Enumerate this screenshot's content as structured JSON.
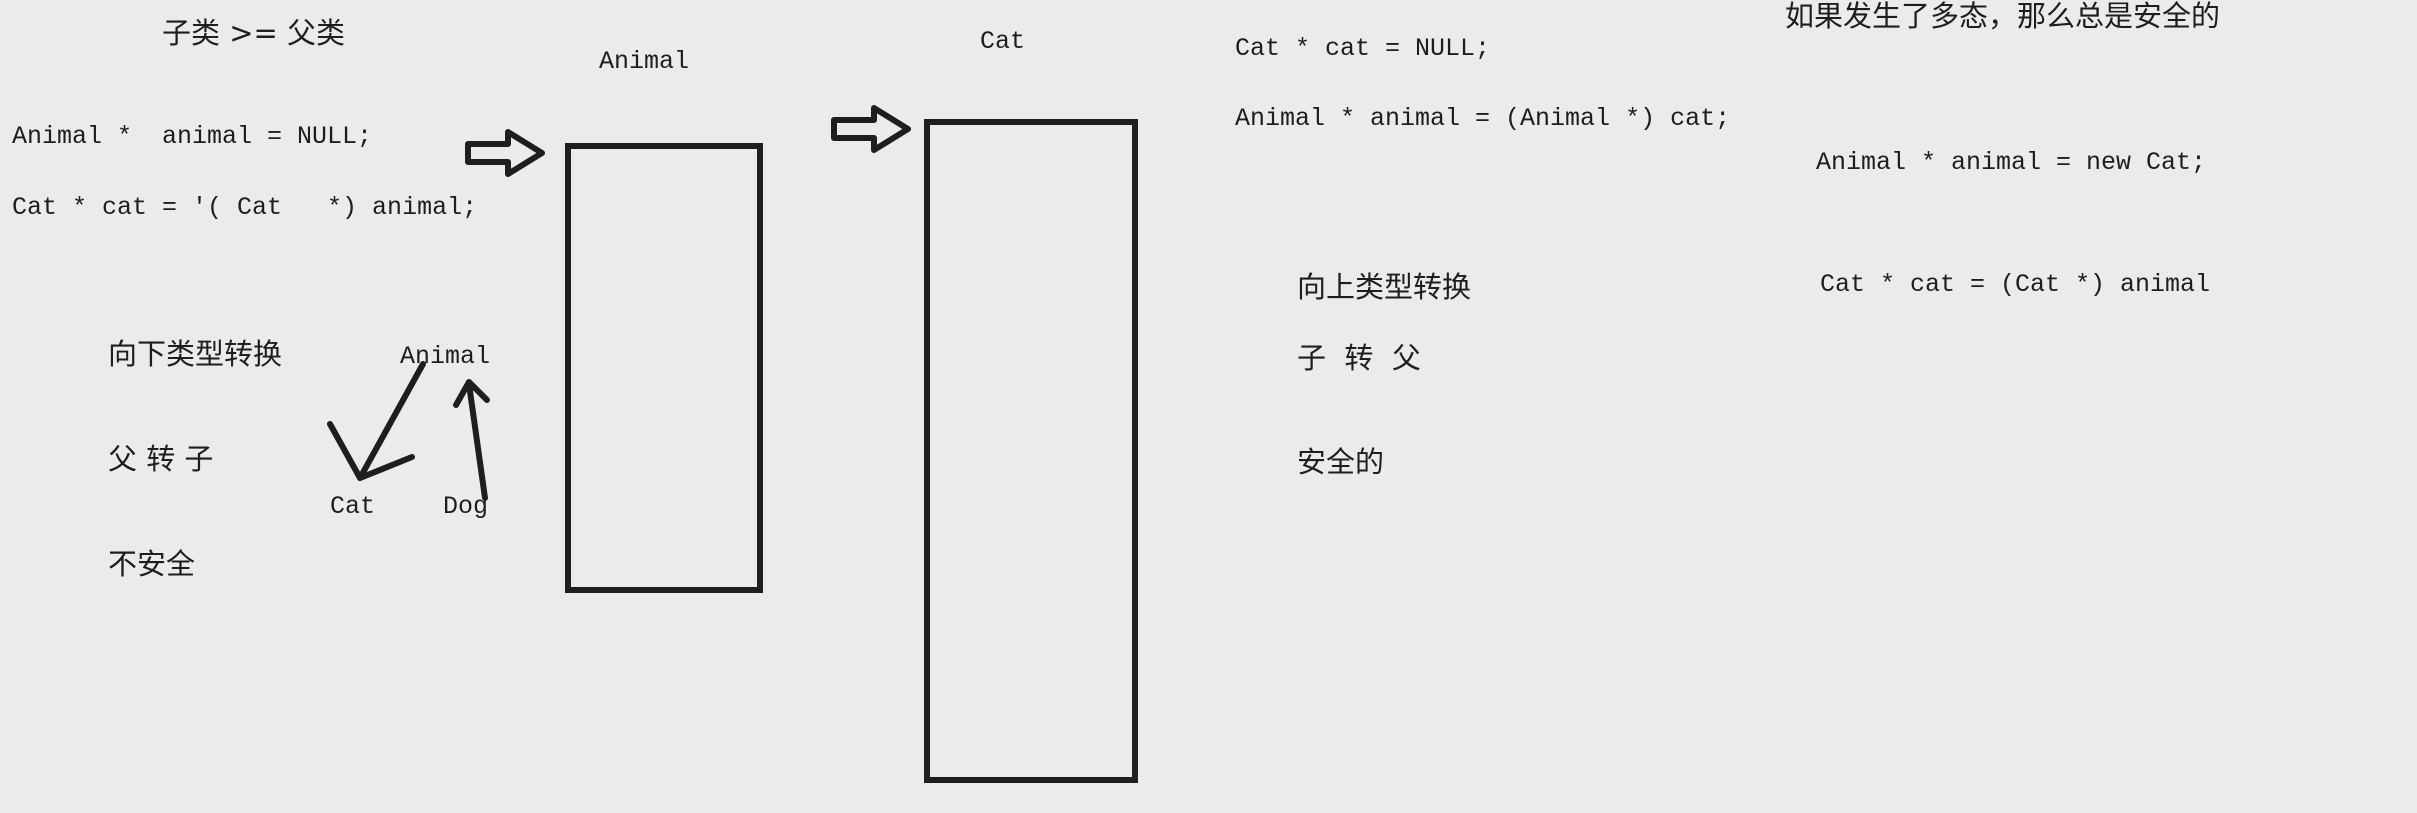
{
  "left": {
    "heading": "子类 >= 父类",
    "code_line1": "Animal *  animal = NULL;",
    "code_line2": "Cat * cat = '( Cat   *) animal;",
    "downcast_title": "向下类型转换",
    "downcast_dir": "父 转 子",
    "downcast_safety": "不安全",
    "tree_root": "Animal",
    "tree_left": "Cat",
    "tree_right": "Dog"
  },
  "middle": {
    "animal_box_label": "Animal",
    "cat_box_label": "Cat"
  },
  "right": {
    "code_line1": "Cat * cat = NULL;",
    "code_line2": "Animal * animal = (Animal *) cat;",
    "upcast_title": "向上类型转换",
    "upcast_dir": "子  转  父",
    "upcast_safety": "安全的"
  },
  "far_right": {
    "polymorphism_note": "如果发生了多态，那么总是安全的",
    "code_line1": "Animal * animal = new Cat;",
    "code_line2": "Cat * cat = (Cat *) animal"
  },
  "colors": {
    "background": "#ebebeb",
    "ink": "#1e1e1e"
  }
}
